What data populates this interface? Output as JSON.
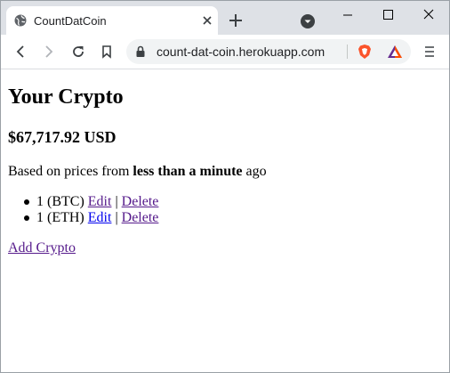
{
  "browser": {
    "tab": {
      "title": "CountDatCoin",
      "favicon": "globe-icon"
    },
    "url": "count-dat-coin.herokuapp.com"
  },
  "page": {
    "title": "Your Crypto",
    "total": "$67,717.92 USD",
    "prices_note": {
      "prefix": "Based on prices from ",
      "emphasis": "less than a minute",
      "suffix": " ago"
    },
    "holdings": [
      {
        "text": "1 (BTC)",
        "edit_label": "Edit",
        "separator": "|",
        "delete_label": "Delete"
      },
      {
        "text": "1 (ETH)",
        "edit_label": "Edit",
        "separator": "|",
        "delete_label": "Delete"
      }
    ],
    "add_link": "Add Crypto"
  },
  "colors": {
    "visited_link": "#551a8b",
    "link": "#0000ee",
    "brave": "#fb542b"
  }
}
